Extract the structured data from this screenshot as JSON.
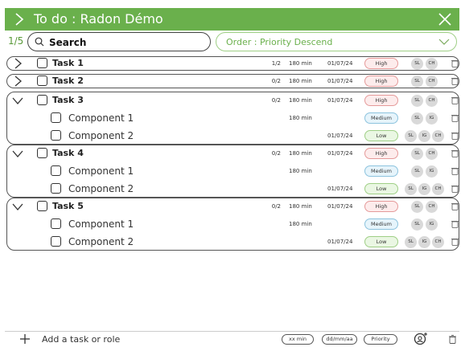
{
  "header": {
    "title": "To do : Radon Démo",
    "accent": "#6ab04c"
  },
  "toolbar": {
    "count": "1/5",
    "search_value": "Search",
    "order_label": "Order : Priority Descend"
  },
  "tasks": [
    {
      "name": "Task 1",
      "sub": "1/2",
      "minutes": "180 min",
      "date": "01/07/24",
      "priority": "High",
      "assignees": [
        "SL",
        "CH"
      ],
      "components": []
    },
    {
      "name": "Task 2",
      "sub": "0/2",
      "minutes": "180 min",
      "date": "01/07/24",
      "priority": "High",
      "assignees": [
        "SL",
        "CH"
      ],
      "components": []
    },
    {
      "name": "Task 3",
      "sub": "0/2",
      "minutes": "180 min",
      "date": "01/07/24",
      "priority": "High",
      "assignees": [
        "SL",
        "CH"
      ],
      "components": [
        {
          "name": "Component 1",
          "minutes": "180 min",
          "date": "",
          "priority": "Medium",
          "assignees": [
            "SL",
            "IG"
          ]
        },
        {
          "name": "Component 2",
          "minutes": "",
          "date": "01/07/24",
          "priority": "Low",
          "assignees": [
            "SL",
            "IG",
            "CH"
          ]
        }
      ]
    },
    {
      "name": "Task 4",
      "sub": "0/2",
      "minutes": "180 min",
      "date": "01/07/24",
      "priority": "High",
      "assignees": [
        "SL",
        "CH"
      ],
      "components": [
        {
          "name": "Component 1",
          "minutes": "180 min",
          "date": "",
          "priority": "Medium",
          "assignees": [
            "SL",
            "IG"
          ]
        },
        {
          "name": "Component 2",
          "minutes": "",
          "date": "01/07/24",
          "priority": "Low",
          "assignees": [
            "SL",
            "IG",
            "CH"
          ]
        }
      ]
    },
    {
      "name": "Task 5",
      "sub": "0/2",
      "minutes": "180 min",
      "date": "01/07/24",
      "priority": "High",
      "assignees": [
        "SL",
        "CH"
      ],
      "components": [
        {
          "name": "Component 1",
          "minutes": "180 min",
          "date": "",
          "priority": "Medium",
          "assignees": [
            "SL",
            "IG"
          ]
        },
        {
          "name": "Component 2",
          "minutes": "",
          "date": "01/07/24",
          "priority": "Low",
          "assignees": [
            "SL",
            "IG",
            "CH"
          ]
        }
      ]
    }
  ],
  "footer": {
    "add_label": "Add a task or role",
    "minutes_placeholder": "xx min",
    "date_placeholder": "dd/mm/aa",
    "priority_label": "Priority"
  },
  "icons": {
    "expand": "chevron-right-icon",
    "collapse": "chevron-down-icon",
    "close": "close-icon",
    "search": "search-icon",
    "trash": "trash-icon",
    "assign": "add-user-icon",
    "add": "plus-icon"
  }
}
